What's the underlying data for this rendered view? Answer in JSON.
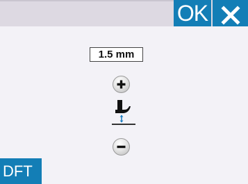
{
  "header": {
    "ok_label": "OK",
    "close_icon": "close-x-icon"
  },
  "setting": {
    "value": "1.5 mm",
    "icon": "presser-foot-height-icon"
  },
  "controls": {
    "increase_icon": "plus-icon",
    "decrease_icon": "minus-icon"
  },
  "footer": {
    "default_label": "DFT"
  },
  "colors": {
    "accent": "#137eb6",
    "background": "#f3f2f7",
    "header_strip": "#ddd9e2",
    "indicator": "#1f7fc2"
  }
}
